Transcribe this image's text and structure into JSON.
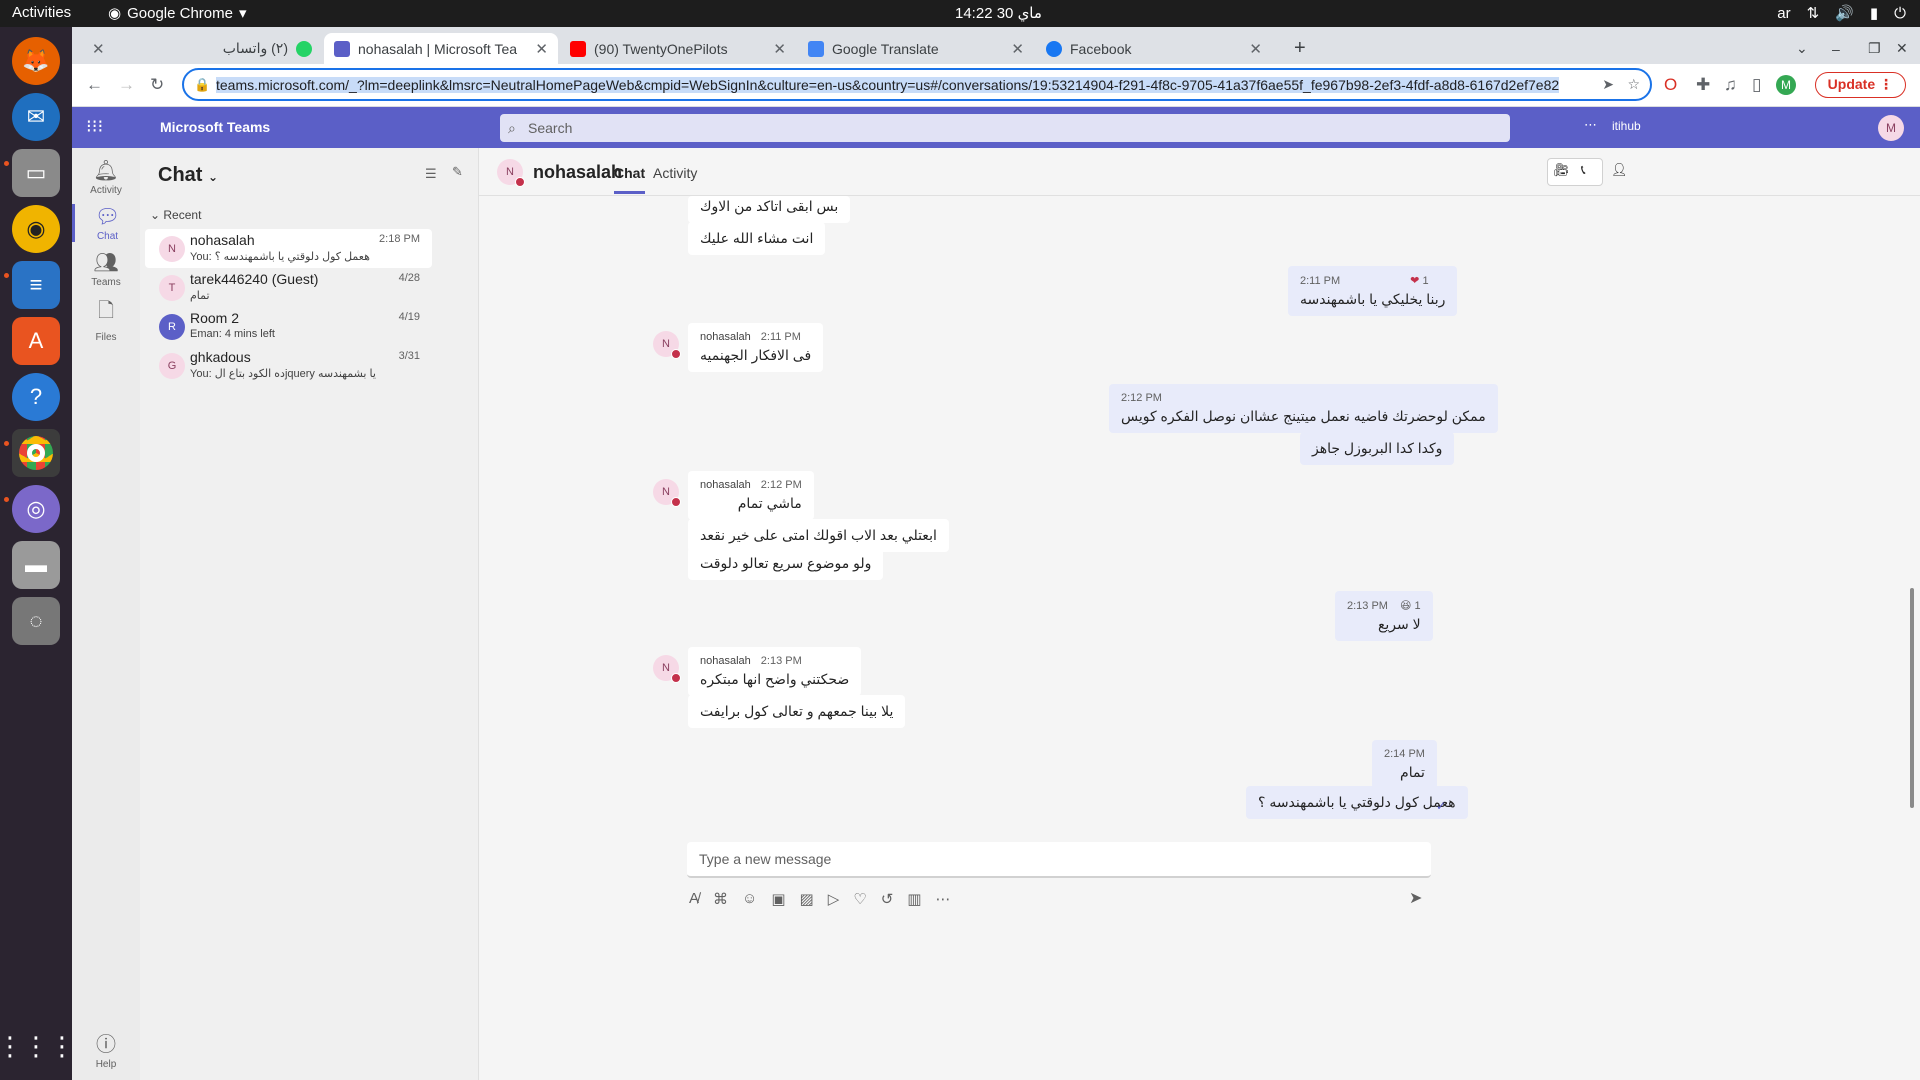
{
  "system": {
    "activities": "Activities",
    "app_menu": "Google Chrome",
    "clock": "14:22  30 ماي",
    "tray_lang": "ar"
  },
  "browser": {
    "tabs": [
      {
        "label": "(٢) واتساب"
      },
      {
        "label": "nohasalah | Microsoft Tea"
      },
      {
        "label": "(90) TwentyOnePilots"
      },
      {
        "label": "Google Translate"
      },
      {
        "label": "Facebook"
      }
    ],
    "url": "teams.microsoft.com/_?lm=deeplink&lmsrc=NeutralHomePageWeb&cmpid=WebSignIn&culture=en-us&country=us#/conversations/19:53214904-f291-4f8c-9705-41a37f6ae55f_fe967b98-2ef3-4fdf-a8d8-6167d2ef7e82",
    "update_label": "Update",
    "profile_initial": "M"
  },
  "teams": {
    "brand": "Microsoft Teams",
    "search_placeholder": "Search",
    "org": "itihub",
    "me_initial": "M"
  },
  "rail": [
    {
      "label": "Activity"
    },
    {
      "label": "Chat"
    },
    {
      "label": "Teams"
    },
    {
      "label": "Files"
    },
    {
      "label": "Help"
    }
  ],
  "chatlist": {
    "title": "Chat",
    "section": "Recent",
    "items": [
      {
        "initial": "N",
        "name": "nohasalah",
        "preview": "You: هعمل كول دلوقتي يا باشمهندسه ؟",
        "time": "2:18 PM"
      },
      {
        "initial": "T",
        "name": "tarek446240 (Guest)",
        "preview": "تمام",
        "time": "4/28"
      },
      {
        "initial": "R",
        "name": "Room 2",
        "preview": "Eman: 4 mins left",
        "time": "4/19"
      },
      {
        "initial": "G",
        "name": "ghkadous",
        "preview": "You: ده الكود بتاع الjquery يا بشمهندسه",
        "time": "3/31"
      }
    ]
  },
  "conversation": {
    "name": "nohasalah",
    "initial": "N",
    "tabs": [
      "Chat",
      "Activity"
    ],
    "messages": [
      {
        "text": "بس ابقى اتاكد من الاوك"
      },
      {
        "text": "انت مشاء الله عليك"
      },
      {
        "time": "2:11 PM",
        "text": "ربنا يخليكي يا باشمهندسه",
        "reaction": "1"
      },
      {
        "sender": "nohasalah",
        "time": "2:11 PM",
        "text": "فى الافكار الجهنميه"
      },
      {
        "time": "2:12 PM",
        "text": "ممكن لوحضرتك فاضيه نعمل ميتينج عشاان نوصل الفكره كويس"
      },
      {
        "text": "وكدا كدا البربوزل جاهز"
      },
      {
        "sender": "nohasalah",
        "time": "2:12 PM",
        "text": "ماشي تمام"
      },
      {
        "text": "ابعتلي بعد الاب اقولك امتى على خير نقعد"
      },
      {
        "text": "ولو موضوع سريع تعالو دلوقت"
      },
      {
        "time": "2:13 PM",
        "text": "لا سريع",
        "reaction": "1"
      },
      {
        "sender": "nohasalah",
        "time": "2:13 PM",
        "text": "ضحكتني واضح انها مبتكره"
      },
      {
        "text": "يلا بينا جمعهم و تعالى كول برايفت"
      },
      {
        "time": "2:14 PM",
        "text": "تمام"
      },
      {
        "text": "هعمل كول دلوقتي يا باشمهندسه ؟"
      }
    ],
    "compose_placeholder": "Type a new message"
  },
  "colors": {
    "teams_purple": "#5b5fc7",
    "my_bubble": "#e8ebfa",
    "presence_busy": "#c4314b"
  }
}
